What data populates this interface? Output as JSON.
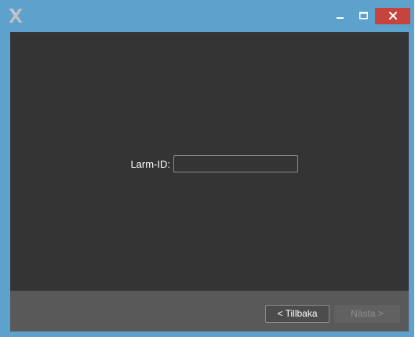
{
  "window": {
    "accent_color": "#5da2cd",
    "close_color": "#c7433e",
    "content_bg": "#343434",
    "footer_bg": "#595959",
    "icons": {
      "app": "app-x-logo-icon",
      "minimize": "minimize-icon",
      "maximize": "maximize-icon",
      "close": "close-icon"
    }
  },
  "form": {
    "label": "Larm-ID:",
    "value": "",
    "placeholder": ""
  },
  "footer": {
    "back_label": "< Tillbaka",
    "next_label": "Nästa >",
    "next_enabled": false
  }
}
